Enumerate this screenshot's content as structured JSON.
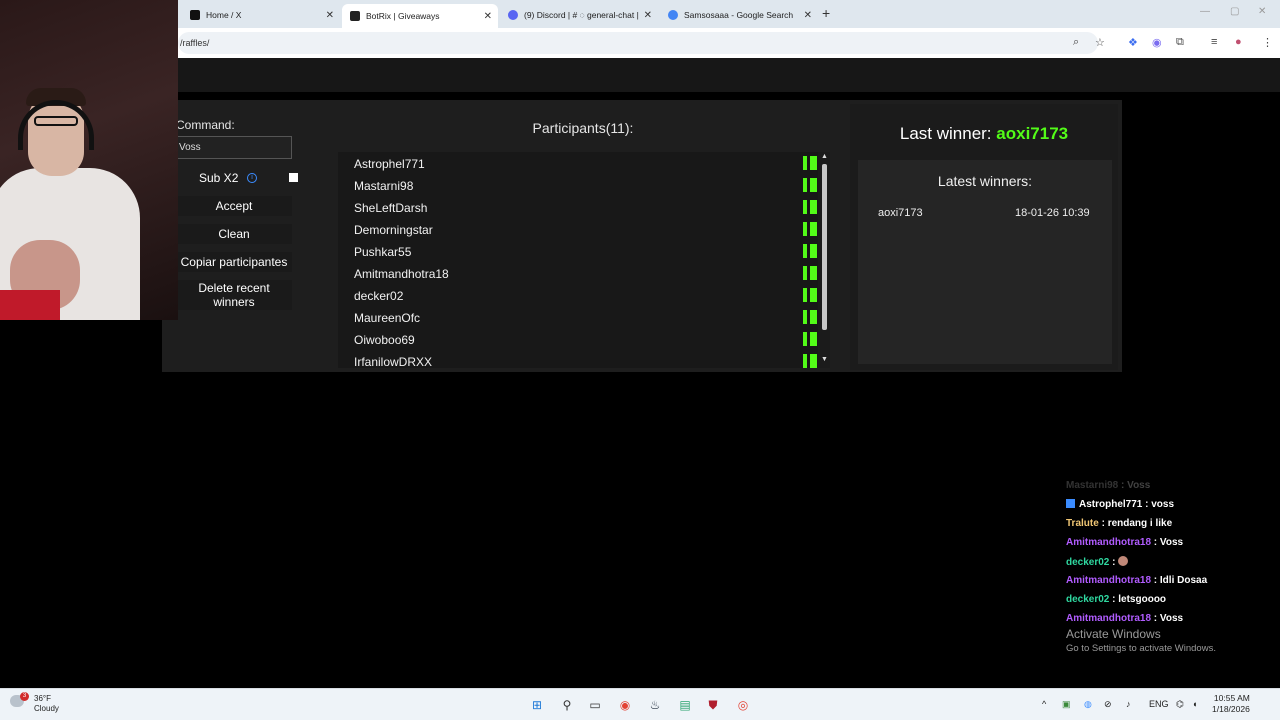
{
  "browser": {
    "tabs": [
      {
        "title": "Home / X",
        "active": false
      },
      {
        "title": "BotRix | Giveaways",
        "active": true
      },
      {
        "title": "(9) Discord | # ◌ general-chat |",
        "active": false
      },
      {
        "title": "Samsosaaa - Google Search",
        "active": false
      }
    ],
    "address": "/raffles/",
    "new_tab": "+"
  },
  "raffle": {
    "command_label": "Command:",
    "command_value": "Voss",
    "sub_label": "Sub X2",
    "info_icon": "i",
    "buttons": {
      "accept": "Accept",
      "clean": "Clean",
      "copy": "Copiar participantes",
      "delete": "Delete recent winners"
    }
  },
  "participants": {
    "title": "Participants(11):",
    "names": [
      "Astrophel771",
      "Mastarni98",
      "SheLeftDarsh",
      "Demorningstar",
      "Pushkar55",
      "Amitmandhotra18",
      "decker02",
      "MaureenOfc",
      "Oiwoboo69",
      "IrfanilowDRXX"
    ]
  },
  "winners": {
    "last_label": "Last winner:",
    "last_name": "aoxi7173",
    "latest_title": "Latest winners:",
    "list": [
      {
        "name": "aoxi7173",
        "date": "18-01-26 10:39"
      }
    ]
  },
  "chat": [
    {
      "user": "Mastarni98",
      "msg": "Voss",
      "color": "#c8c8c8",
      "faded": true,
      "badge": false
    },
    {
      "user": "Astrophel771",
      "msg": "voss",
      "color": "#ffffff",
      "faded": false,
      "badge": true
    },
    {
      "user": "Tralute",
      "msg": "rendang i like",
      "color": "#f0c674",
      "faded": false,
      "badge": false
    },
    {
      "user": "Amitmandhotra18",
      "msg": "Voss",
      "color": "#b15cff",
      "faded": false,
      "badge": false
    },
    {
      "user": "decker02",
      "msg": "",
      "color": "#2fd8a0",
      "faded": false,
      "badge": false,
      "emote": true
    },
    {
      "user": "Amitmandhotra18",
      "msg": "Idli Dosaa",
      "color": "#b15cff",
      "faded": false,
      "badge": false
    },
    {
      "user": "decker02",
      "msg": "letsgoooo",
      "color": "#2fd8a0",
      "faded": false,
      "badge": false
    },
    {
      "user": "Amitmandhotra18",
      "msg": "Voss",
      "color": "#b15cff",
      "faded": false,
      "badge": false
    }
  ],
  "windows": {
    "activate_title": "Activate Windows",
    "activate_sub": "Go to Settings to activate Windows."
  },
  "taskbar": {
    "weather_temp": "36°F",
    "weather_desc": "Cloudy",
    "weather_badge": "3",
    "lang": "ENG",
    "time": "10:55 AM",
    "date": "1/18/2026"
  },
  "colors": {
    "kick_green": "#53fc18",
    "panel_bg": "#1e1e1e",
    "accent_blue": "#3b8cff"
  }
}
